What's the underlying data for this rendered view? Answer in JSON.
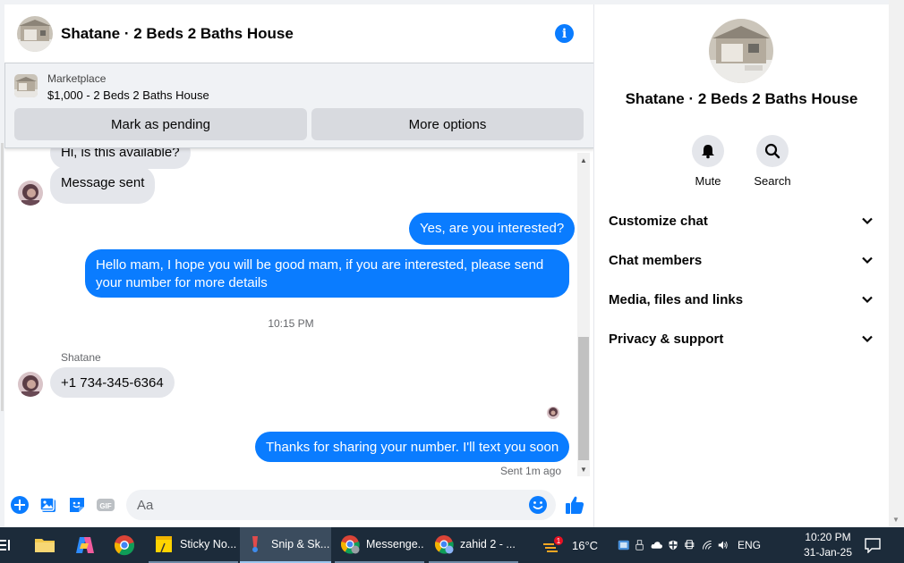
{
  "chat": {
    "title": "Shatane · 2 Beds 2 Baths House",
    "marketplace": {
      "label": "Marketplace",
      "listing": "$1,000 - 2 Beds 2 Baths House",
      "mark_pending": "Mark as pending",
      "more_options": "More options"
    },
    "messages": {
      "partial_hidden": "Hi, is this available?",
      "incoming_1": "Message sent",
      "outgoing_1": "Yes, are you interested?",
      "outgoing_2_line1": "Hello mam, I hope you will be good mam, if you are interested, please send",
      "outgoing_2_line2": "your number for more details",
      "timestamp": "10:15 PM",
      "sender": "Shatane",
      "incoming_2": "+1 734-345-6364",
      "outgoing_3": "Thanks for sharing your number. I'll text you soon",
      "sent_status": "Sent 1m ago"
    },
    "composer": {
      "placeholder": "Aa",
      "value": ""
    }
  },
  "info_panel": {
    "title": "Shatane · 2 Beds 2 Baths House",
    "actions": {
      "mute": "Mute",
      "search": "Search"
    },
    "sections": [
      "Customize chat",
      "Chat members",
      "Media, files and links",
      "Privacy & support"
    ]
  },
  "taskbar": {
    "apps": {
      "sticky_notes": "Sticky No...",
      "snip": "Snip & Sk...",
      "messenger": "Messenge...",
      "zahid": "zahid 2 - ..."
    },
    "weather": "16°C",
    "weather_badge": "1",
    "language": "ENG",
    "time": "10:20 PM",
    "date": "31-Jan-25"
  },
  "colors": {
    "messenger_blue": "#0a7cff",
    "bubble_gray": "#e4e6eb",
    "taskbar": "#1c2b3a"
  }
}
